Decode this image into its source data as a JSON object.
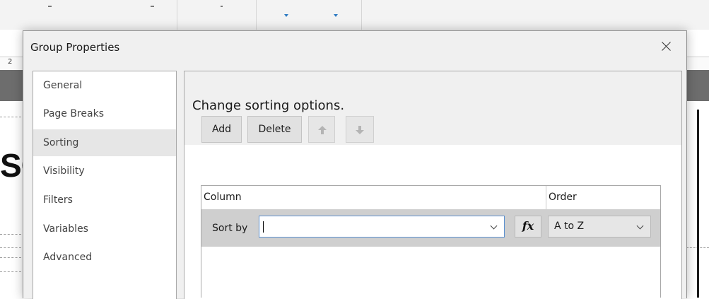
{
  "dialog": {
    "title": "Group Properties",
    "close_icon": "close-icon"
  },
  "nav": {
    "items": [
      {
        "label": "General",
        "selected": false
      },
      {
        "label": "Page Breaks",
        "selected": false
      },
      {
        "label": "Sorting",
        "selected": true
      },
      {
        "label": "Visibility",
        "selected": false
      },
      {
        "label": "Filters",
        "selected": false
      },
      {
        "label": "Variables",
        "selected": false
      },
      {
        "label": "Advanced",
        "selected": false
      }
    ]
  },
  "content": {
    "heading": "Change sorting options.",
    "toolbar": {
      "add_label": "Add",
      "delete_label": "Delete",
      "move_up_icon": "arrow-up-icon",
      "move_down_icon": "arrow-down-icon"
    },
    "grid": {
      "columns": [
        "Column",
        "Order"
      ],
      "rows": [
        {
          "label": "Sort by",
          "column_value": "",
          "expression_label": "fx",
          "order_value": "A to Z"
        }
      ]
    }
  },
  "background": {
    "ruler_numbers": [
      "2"
    ],
    "canvas_text": "SC"
  },
  "colors": {
    "dialog_bg": "#f0f0f0",
    "selected_nav_bg": "#e6e6e6",
    "grid_row_bg": "#cfcfcf",
    "focus_border": "#5a8fcf",
    "toolbar_accent": "#2b79c2"
  }
}
